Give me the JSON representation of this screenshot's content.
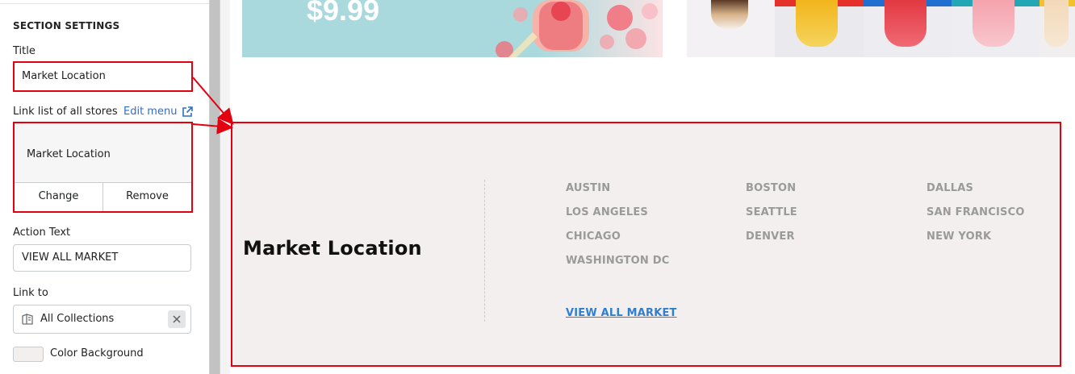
{
  "settings": {
    "section_title": "SECTION SETTINGS",
    "title_label": "Title",
    "title_value": "Market Location",
    "link_list_label": "Link list of all stores",
    "edit_menu_label": "Edit menu",
    "menu_name": "Market Location",
    "change_label": "Change",
    "remove_label": "Remove",
    "action_text_label": "Action Text",
    "action_text_value": "VIEW ALL MARKET",
    "link_to_label": "Link to",
    "link_to_value": "All Collections",
    "color_bg_label": "Color Background",
    "color_bg_value": "#f3efee"
  },
  "preview": {
    "banner_price": "$9.99",
    "market_title": "Market Location",
    "cities": [
      [
        "AUSTIN",
        "BOSTON",
        "DALLAS"
      ],
      [
        "LOS ANGELES",
        "SEATTLE",
        "SAN FRANCISCO"
      ],
      [
        "CHICAGO",
        "DENVER",
        "NEW YORK"
      ],
      [
        "WASHINGTON DC"
      ]
    ],
    "view_all": "VIEW ALL MARKET"
  },
  "colors": {
    "highlight": "#e3000f",
    "link": "#2c6ecb",
    "market_bg": "#f3efee",
    "city_text": "#9a9a9a"
  }
}
